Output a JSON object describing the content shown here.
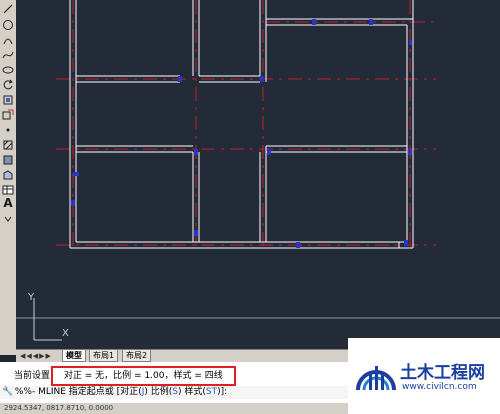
{
  "layout_tabs": [
    {
      "label": "模型",
      "active": true
    },
    {
      "label": "布局1",
      "active": false
    },
    {
      "label": "布局2",
      "active": false
    }
  ],
  "tab_nav_glyphs": "◀◀◀▶▶",
  "axis": {
    "x_label": "X",
    "y_label": "Y"
  },
  "toolbar": {
    "text_tool_glyph": "A"
  },
  "command": {
    "history_prefix": "当前设置:",
    "history_value": "对正 = 无，比例 = 1.00，样式 = 四线",
    "prompt_prefix": "%%- MLINE 指定起点或 [",
    "prompt_opt1_text": "对正(",
    "prompt_opt1_key": "J",
    "prompt_opt2_text": ") 比例(",
    "prompt_opt2_key": "S",
    "prompt_opt3_text": ") 样式(",
    "prompt_opt3_key": "ST",
    "prompt_suffix": ")]:",
    "coordinates": "2924.5347, 0817.8710, 0.0000"
  },
  "watermark": {
    "title": "土木工程网",
    "url": "www.civilcn.com"
  },
  "colors": {
    "wall": "#ffffff",
    "centerline": "#c0202a",
    "node": "#2a34c8",
    "background": "#232a38",
    "highlight": "#e02020",
    "watermark": "#1a3fa0"
  }
}
